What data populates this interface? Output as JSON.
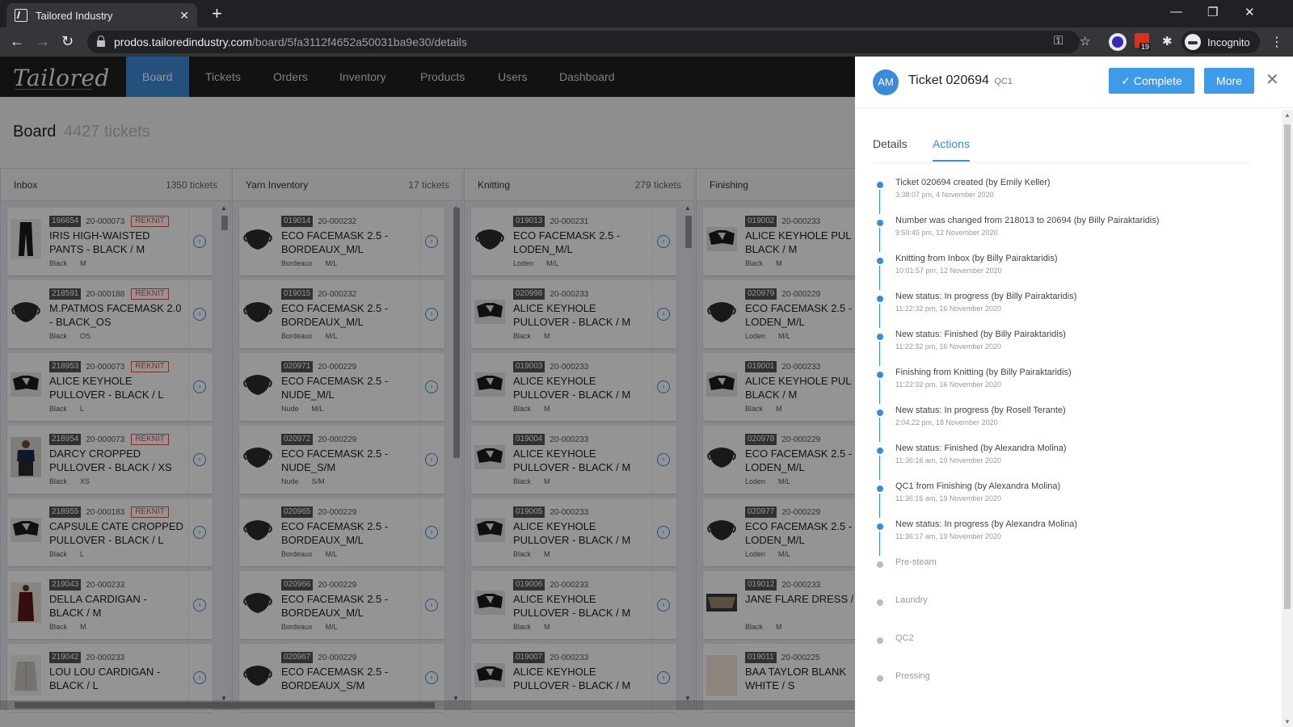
{
  "browser": {
    "tab_title": "Tailored Industry",
    "url_host": "prodos.tailoredindustry.com",
    "url_path": "/board/5fa3112f4652a50031ba9e30/details",
    "profile_label": "Incognito",
    "calendar_badge": "19"
  },
  "app": {
    "logo_text": "Tailored",
    "nav": [
      "Board",
      "Tickets",
      "Orders",
      "Inventory",
      "Products",
      "Users",
      "Dashboard"
    ],
    "board_title": "Board",
    "board_count": "4427 tickets"
  },
  "columns": [
    {
      "name": "Inbox",
      "count": "1350 tickets",
      "cards": [
        {
          "id": "196654",
          "order": "20-000073",
          "reknit": "REKNIT",
          "name": "IRIS HIGH-WAISTED PANTS - BLACK / M",
          "color": "Black",
          "size": "M",
          "img": "pants"
        },
        {
          "id": "218591",
          "order": "20-000188",
          "reknit": "REKNIT",
          "name": "M.PATMOS FACEMASK 2.0 - BLACK_OS",
          "color": "Black",
          "size": "OS",
          "img": "mask"
        },
        {
          "id": "218953",
          "order": "20-000073",
          "reknit": "REKNIT",
          "name": "ALICE KEYHOLE PULLOVER - BLACK / L",
          "color": "Black",
          "size": "L",
          "img": "pullover"
        },
        {
          "id": "218954",
          "order": "20-000073",
          "reknit": "REKNIT",
          "name": "DARCY CROPPED PULLOVER - BLACK / XS",
          "color": "Black",
          "size": "XS",
          "img": "darcy"
        },
        {
          "id": "218955",
          "order": "20-000183",
          "reknit": "REKNIT",
          "name": "CAPSULE CATE CROPPED PULLOVER - BLACK / L",
          "color": "Black",
          "size": "L",
          "img": "pullover"
        },
        {
          "id": "219043",
          "order": "20-000233",
          "reknit": "",
          "name": "DELLA CARDIGAN - BLACK / M",
          "color": "Black",
          "size": "M",
          "img": "cardigan"
        },
        {
          "id": "219042",
          "order": "20-000233",
          "reknit": "",
          "name": "LOU LOU CARDIGAN - BLACK / L",
          "color": "",
          "size": "",
          "img": "loulou"
        }
      ]
    },
    {
      "name": "Yarn Inventory",
      "count": "17 tickets",
      "cards": [
        {
          "id": "019014",
          "order": "20-000232",
          "reknit": "",
          "name": "ECO FACEMASK 2.5 - BORDEAUX_M/L",
          "color": "Bordeaux",
          "size": "M/L",
          "img": "mask"
        },
        {
          "id": "019015",
          "order": "20-000232",
          "reknit": "",
          "name": "ECO FACEMASK 2.5 - BORDEAUX_M/L",
          "color": "Bordeaux",
          "size": "M/L",
          "img": "mask"
        },
        {
          "id": "020971",
          "order": "20-000229",
          "reknit": "",
          "name": "ECO FACEMASK 2.5 - NUDE_M/L",
          "color": "Nude",
          "size": "M/L",
          "img": "mask"
        },
        {
          "id": "020972",
          "order": "20-000229",
          "reknit": "",
          "name": "ECO FACEMASK 2.5 - NUDE_S/M",
          "color": "Nude",
          "size": "S/M",
          "img": "mask"
        },
        {
          "id": "020965",
          "order": "20-000229",
          "reknit": "",
          "name": "ECO FACEMASK 2.5 - BORDEAUX_M/L",
          "color": "Bordeaux",
          "size": "M/L",
          "img": "mask"
        },
        {
          "id": "020966",
          "order": "20-000229",
          "reknit": "",
          "name": "ECO FACEMASK 2.5 - BORDEAUX_M/L",
          "color": "Bordeaux",
          "size": "M/L",
          "img": "mask"
        },
        {
          "id": "020967",
          "order": "20-000229",
          "reknit": "",
          "name": "ECO FACEMASK 2.5 - BORDEAUX_S/M",
          "color": "",
          "size": "",
          "img": "mask"
        }
      ]
    },
    {
      "name": "Knitting",
      "count": "279 tickets",
      "cards": [
        {
          "id": "019013",
          "order": "20-000231",
          "reknit": "",
          "name": "ECO FACEMASK 2.5 - LODEN_M/L",
          "color": "Loden",
          "size": "M/L",
          "img": "mask"
        },
        {
          "id": "020998",
          "order": "20-000233",
          "reknit": "",
          "name": "ALICE KEYHOLE PULLOVER - BLACK / M",
          "color": "Black",
          "size": "M",
          "img": "pullover"
        },
        {
          "id": "019003",
          "order": "20-000233",
          "reknit": "",
          "name": "ALICE KEYHOLE PULLOVER - BLACK / M",
          "color": "Black",
          "size": "M",
          "img": "pullover"
        },
        {
          "id": "019004",
          "order": "20-000233",
          "reknit": "",
          "name": "ALICE KEYHOLE PULLOVER - BLACK / M",
          "color": "Black",
          "size": "M",
          "img": "pullover"
        },
        {
          "id": "019005",
          "order": "20-000233",
          "reknit": "",
          "name": "ALICE KEYHOLE PULLOVER - BLACK / M",
          "color": "Black",
          "size": "M",
          "img": "pullover"
        },
        {
          "id": "019006",
          "order": "20-000233",
          "reknit": "",
          "name": "ALICE KEYHOLE PULLOVER - BLACK / M",
          "color": "Black",
          "size": "M",
          "img": "pullover"
        },
        {
          "id": "019007",
          "order": "20-000233",
          "reknit": "",
          "name": "ALICE KEYHOLE PULLOVER - BLACK / M",
          "color": "",
          "size": "",
          "img": "pullover"
        }
      ]
    },
    {
      "name": "Finishing",
      "count": "",
      "cards": [
        {
          "id": "019002",
          "order": "20-000233",
          "reknit": "",
          "name": "ALICE KEYHOLE PUL BLACK / M",
          "color": "Black",
          "size": "M",
          "img": "pullover"
        },
        {
          "id": "020979",
          "order": "20-000229",
          "reknit": "",
          "name": "ECO FACEMASK 2.5 - LODEN_M/L",
          "color": "Loden",
          "size": "M/L",
          "img": "mask"
        },
        {
          "id": "019001",
          "order": "20-000233",
          "reknit": "",
          "name": "ALICE KEYHOLE PUL BLACK / M",
          "color": "Black",
          "size": "M",
          "img": "pullover"
        },
        {
          "id": "020978",
          "order": "20-000229",
          "reknit": "",
          "name": "ECO FACEMASK 2.5 - LODEN_M/L",
          "color": "Loden",
          "size": "M/L",
          "img": "mask"
        },
        {
          "id": "020977",
          "order": "20-000229",
          "reknit": "",
          "name": "ECO FACEMASK 2.5 - LODEN_M/L",
          "color": "Loden",
          "size": "M/L",
          "img": "mask"
        },
        {
          "id": "019012",
          "order": "20-000233",
          "reknit": "",
          "name": "JANE FLARE DRESS / M",
          "color": "Black",
          "size": "M",
          "img": "dress"
        },
        {
          "id": "019011",
          "order": "20-000225",
          "reknit": "",
          "name": "BAA TAYLOR BLANK WHITE / S",
          "color": "",
          "size": "",
          "img": "white"
        }
      ]
    }
  ],
  "panel": {
    "avatar": "AM",
    "ticket_title": "Ticket 020694",
    "stage": "QC1",
    "complete_label": "✓ Complete",
    "more_label": "More",
    "tabs": [
      "Details",
      "Actions"
    ],
    "timeline": [
      {
        "text": "Ticket 020694 created (by Emily Keller)",
        "time": "3:38:07 pm, 4 November 2020",
        "done": true
      },
      {
        "text": "Number was changed from 218013 to 20694 (by Billy Pairaktaridis)",
        "time": "9:59:45 pm, 12 November 2020",
        "done": true
      },
      {
        "text": "Knitting from Inbox (by Billy Pairaktaridis)",
        "time": "10:01:57 pm, 12 November 2020",
        "done": true
      },
      {
        "text": "New status: In progress (by Billy Pairaktaridis)",
        "time": "11:22:32 pm, 16 November 2020",
        "done": true
      },
      {
        "text": "New status: Finished (by Billy Pairaktaridis)",
        "time": "11:22:32 pm, 16 November 2020",
        "done": true
      },
      {
        "text": "Finishing from Knitting (by Billy Pairaktaridis)",
        "time": "11:22:32 pm, 16 November 2020",
        "done": true
      },
      {
        "text": "New status: In progress (by Rosell Terante)",
        "time": "2:04:22 pm, 18 November 2020",
        "done": true
      },
      {
        "text": "New status: Finished (by Alexandra Molina)",
        "time": "11:36:16 am, 19 November 2020",
        "done": true
      },
      {
        "text": "QC1 from Finishing (by Alexandra Molina)",
        "time": "11:36:16 am, 19 November 2020",
        "done": true
      },
      {
        "text": "New status: In progress (by Alexandra Molina)",
        "time": "11:36:17 am, 19 November 2020",
        "done": true
      },
      {
        "text": "Pre-steam",
        "time": "",
        "done": false
      },
      {
        "text": "Laundry",
        "time": "",
        "done": false
      },
      {
        "text": "QC2",
        "time": "",
        "done": false
      },
      {
        "text": "Pressing",
        "time": "",
        "done": false
      }
    ]
  },
  "colors": {
    "accent": "#3d8bd8",
    "button": "#3d9be9",
    "reknit": "#d9534f",
    "nav_bg": "#1f1f1f"
  }
}
